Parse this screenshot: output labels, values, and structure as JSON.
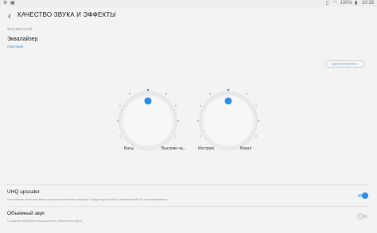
{
  "status_bar": {
    "left_icons": [
      "settings-icon",
      "image-icon"
    ],
    "right_icons": [
      "vibrate-icon",
      "wifi-icon",
      "battery-icon"
    ],
    "battery": "100%",
    "time": "10:38"
  },
  "app_bar": {
    "back_icon": "back-arrow-icon",
    "title": "КАЧЕСТВО ЗВУКА И ЭФФЕКТЫ"
  },
  "section_header": "SOUNDALIVE",
  "equalizer": {
    "title": "Эквалайзер",
    "subtitle": "Обычный"
  },
  "advanced_button": "ДОПОЛНИТЕЛ.",
  "knobs": [
    {
      "name": "bass-treble",
      "left_label": "Басы",
      "right_label": "Высокие ча..."
    },
    {
      "name": "instrument-vocal",
      "left_label": "Инструм.",
      "right_label": "Вокал"
    }
  ],
  "settings": [
    {
      "title": "UHQ upscaler",
      "subtitle": "Улучшение качества звука при прослушивании музыки и видео для лучших впечатлений от прослушивания.",
      "enabled": true
    },
    {
      "title": "Объемный звук",
      "subtitle": "Создание эффекта насыщенного объемного звука.",
      "enabled": false
    }
  ],
  "colors": {
    "accent": "#3a8fd6",
    "knob_dot": "#2f8fe6",
    "background": "#f3f3f3"
  }
}
